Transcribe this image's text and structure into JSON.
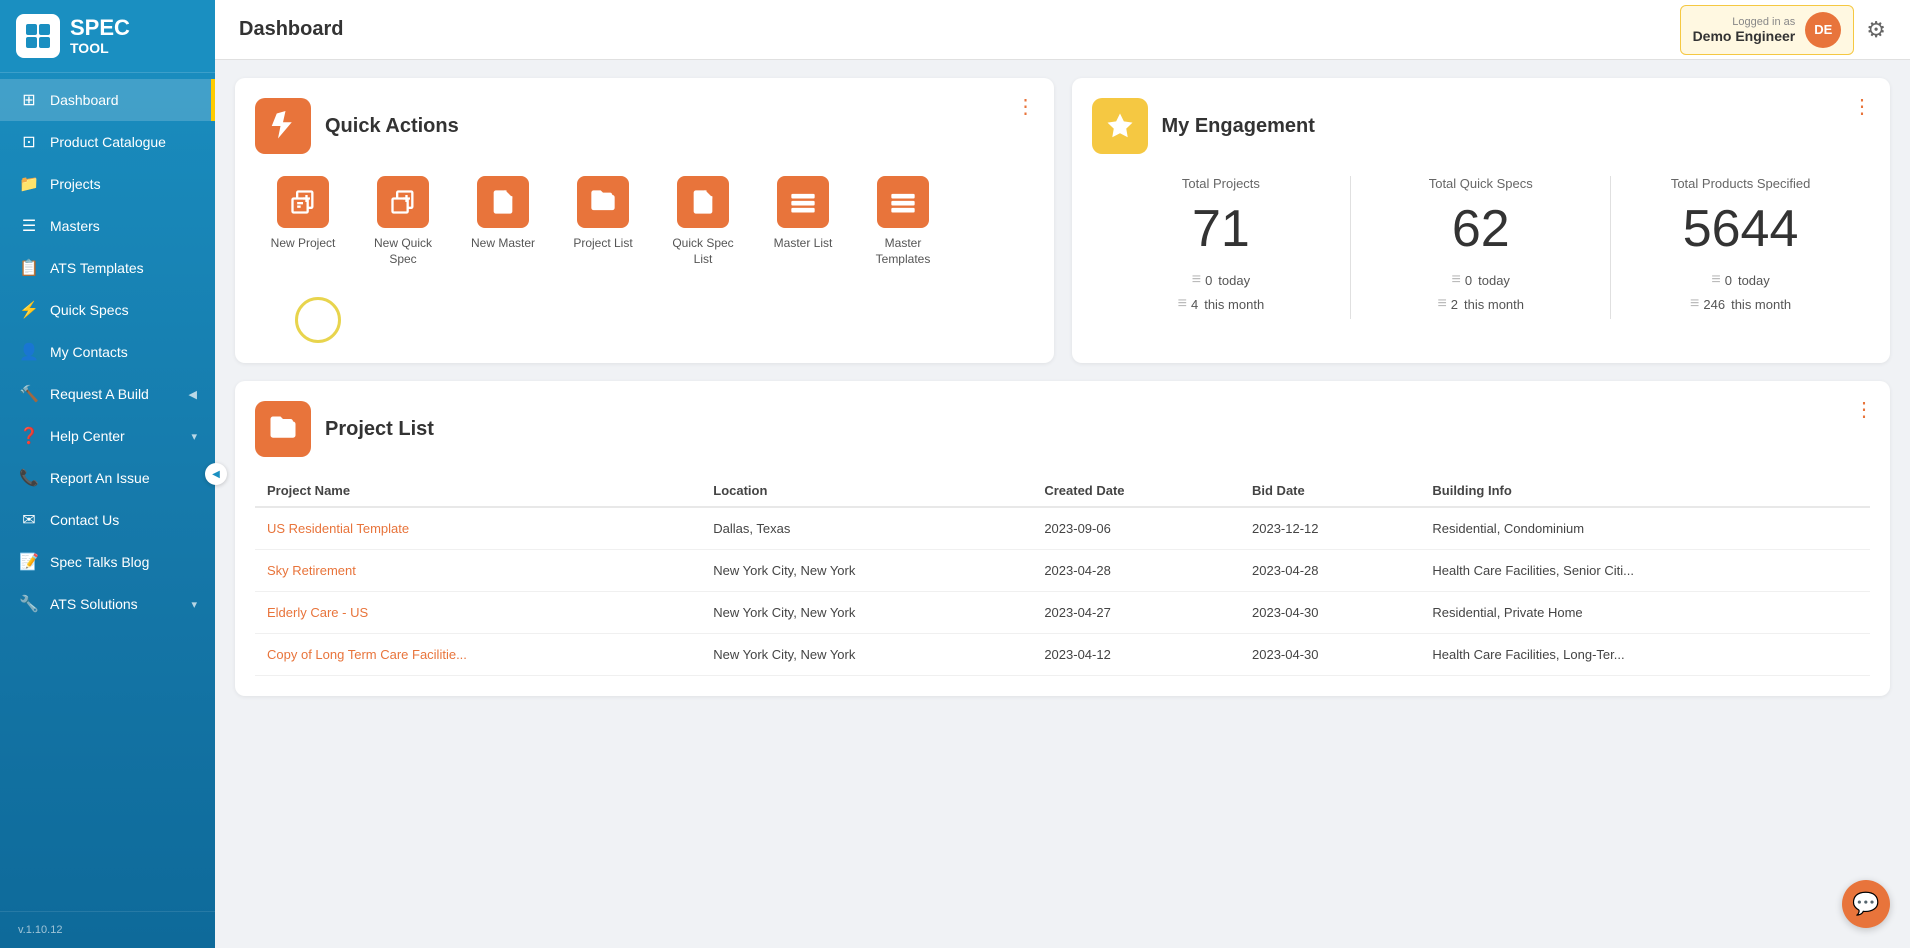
{
  "app": {
    "name": "SPEC",
    "sub": "TOOL",
    "version": "v.1.10.12"
  },
  "header": {
    "title": "Dashboard",
    "user_logged_as": "Logged in as",
    "user_name": "Demo Engineer",
    "user_initials": "DE",
    "settings_label": "Settings"
  },
  "sidebar": {
    "items": [
      {
        "id": "dashboard",
        "label": "Dashboard",
        "active": true
      },
      {
        "id": "product-catalogue",
        "label": "Product Catalogue",
        "active": false
      },
      {
        "id": "projects",
        "label": "Projects",
        "active": false
      },
      {
        "id": "masters",
        "label": "Masters",
        "active": false
      },
      {
        "id": "ats-templates",
        "label": "ATS Templates",
        "active": false
      },
      {
        "id": "quick-specs",
        "label": "Quick Specs",
        "active": false
      },
      {
        "id": "my-contacts",
        "label": "My Contacts",
        "active": false
      },
      {
        "id": "request-a-build",
        "label": "Request A Build",
        "active": false,
        "hasChevron": true
      },
      {
        "id": "help-center",
        "label": "Help Center",
        "active": false,
        "hasChevron": true
      },
      {
        "id": "report-an-issue",
        "label": "Report An Issue",
        "active": false
      },
      {
        "id": "contact-us",
        "label": "Contact Us",
        "active": false
      },
      {
        "id": "spec-talks-blog",
        "label": "Spec Talks Blog",
        "active": false
      },
      {
        "id": "ats-solutions",
        "label": "ATS Solutions",
        "active": false,
        "hasChevron": true
      }
    ]
  },
  "quick_actions": {
    "title": "Quick Actions",
    "items": [
      {
        "id": "new-project",
        "label": "New Project"
      },
      {
        "id": "new-quick-spec",
        "label": "New Quick Spec"
      },
      {
        "id": "new-master",
        "label": "New Master"
      },
      {
        "id": "project-list",
        "label": "Project List"
      },
      {
        "id": "quick-spec-list",
        "label": "Quick Spec List"
      },
      {
        "id": "master-list",
        "label": "Master List"
      },
      {
        "id": "master-templates",
        "label": "Master Templates"
      }
    ]
  },
  "engagement": {
    "title": "My Engagement",
    "stats": [
      {
        "label": "Total Projects",
        "value": "71",
        "today_count": "0",
        "today_label": "today",
        "month_count": "4",
        "month_label": "this month"
      },
      {
        "label": "Total Quick Specs",
        "value": "62",
        "today_count": "0",
        "today_label": "today",
        "month_count": "2",
        "month_label": "this month"
      },
      {
        "label": "Total Products Specified",
        "value": "5644",
        "today_count": "0",
        "today_label": "today",
        "month_count": "246",
        "month_label": "this month"
      }
    ]
  },
  "project_list": {
    "title": "Project List",
    "columns": [
      "Project Name",
      "Location",
      "Created Date",
      "Bid Date",
      "Building Info"
    ],
    "rows": [
      {
        "name": "US Residential Template",
        "location": "Dallas, Texas",
        "created": "2023-09-06",
        "bid": "2023-12-12",
        "building": "Residential, Condominium"
      },
      {
        "name": "Sky Retirement",
        "location": "New York City, New York",
        "created": "2023-04-28",
        "bid": "2023-04-28",
        "building": "Health Care Facilities, Senior Citi..."
      },
      {
        "name": "Elderly Care - US",
        "location": "New York City, New York",
        "created": "2023-04-27",
        "bid": "2023-04-30",
        "building": "Residential, Private Home"
      },
      {
        "name": "Copy of Long Term Care Facilitie...",
        "location": "New York City, New York",
        "created": "2023-04-12",
        "bid": "2023-04-30",
        "building": "Health Care Facilities, Long-Ter..."
      }
    ]
  },
  "colors": {
    "orange": "#e8743b",
    "blue": "#1a8fc1",
    "yellow_accent": "#e8d44d",
    "star_yellow": "#f5c842"
  }
}
